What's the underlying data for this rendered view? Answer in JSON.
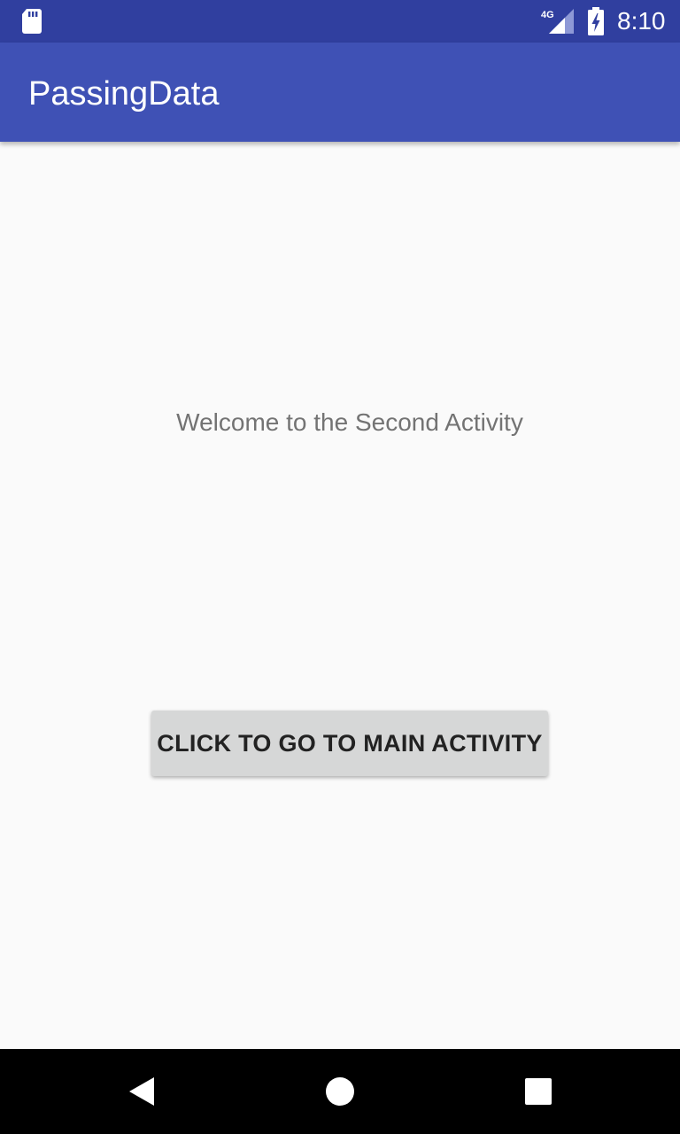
{
  "status_bar": {
    "network_type": "4G",
    "time": "8:10",
    "icons": [
      "sd-card-icon",
      "signal-icon",
      "battery-charging-icon"
    ]
  },
  "app_bar": {
    "title": "PassingData"
  },
  "main": {
    "welcome_text": "Welcome to the Second Activity",
    "button_label": "CLICK TO GO TO MAIN ACTIVITY"
  },
  "nav_bar": {
    "icons": [
      "back-icon",
      "home-icon",
      "recents-icon"
    ]
  },
  "colors": {
    "status_bar": "#303f9f",
    "app_bar": "#3f51b5",
    "background": "#fafafa",
    "button": "#d6d7d7",
    "nav_bar": "#000000"
  }
}
